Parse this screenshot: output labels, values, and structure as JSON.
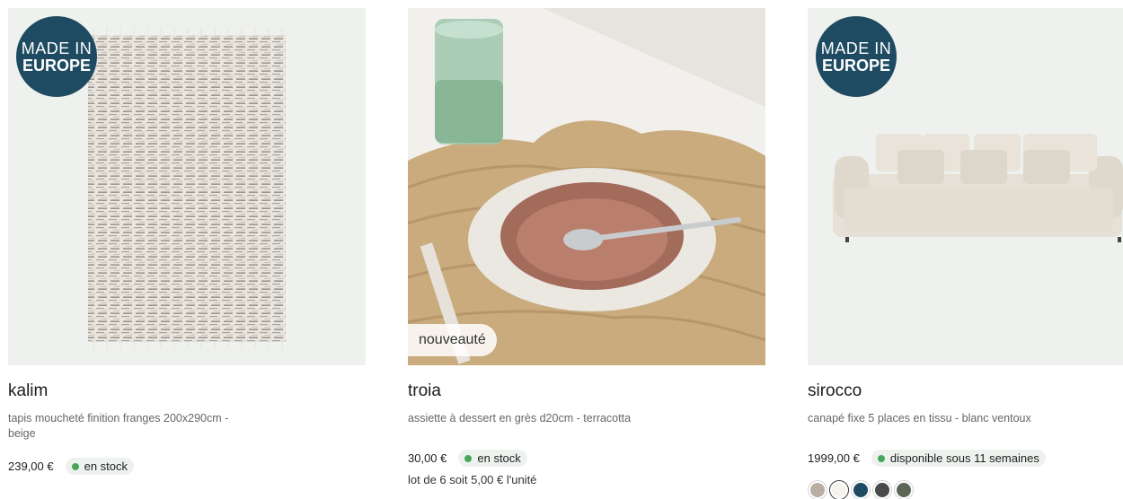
{
  "products": [
    {
      "badge": {
        "line1": "MADE IN",
        "line2": "EUROPE"
      },
      "name": "kalim",
      "description": "tapis moucheté finition franges 200x290cm - beige",
      "price": "239,00 €",
      "stock": "en stock"
    },
    {
      "tag": "nouveauté",
      "name": "troia",
      "description": "assiette à dessert en grès d20cm - terracotta",
      "price": "30,00 €",
      "stock": "en stock",
      "lot": "lot de 6 soit 5,00 € l'unité"
    },
    {
      "badge": {
        "line1": "MADE IN",
        "line2": "EUROPE"
      },
      "name": "sirocco",
      "description": "canapé fixe 5 places en tissu - blanc ventoux",
      "price": "1999,00 €",
      "stock": "disponible sous 11 semaines",
      "swatches": [
        "#b9aea3",
        "#f5f3ea",
        "#1e4b61",
        "#4a4a4a",
        "#5b6656"
      ]
    }
  ],
  "colors": {
    "badge_bg": "#1e4b61",
    "stock_dot": "#47a65c",
    "stock_pill_bg": "#eef2ee"
  }
}
